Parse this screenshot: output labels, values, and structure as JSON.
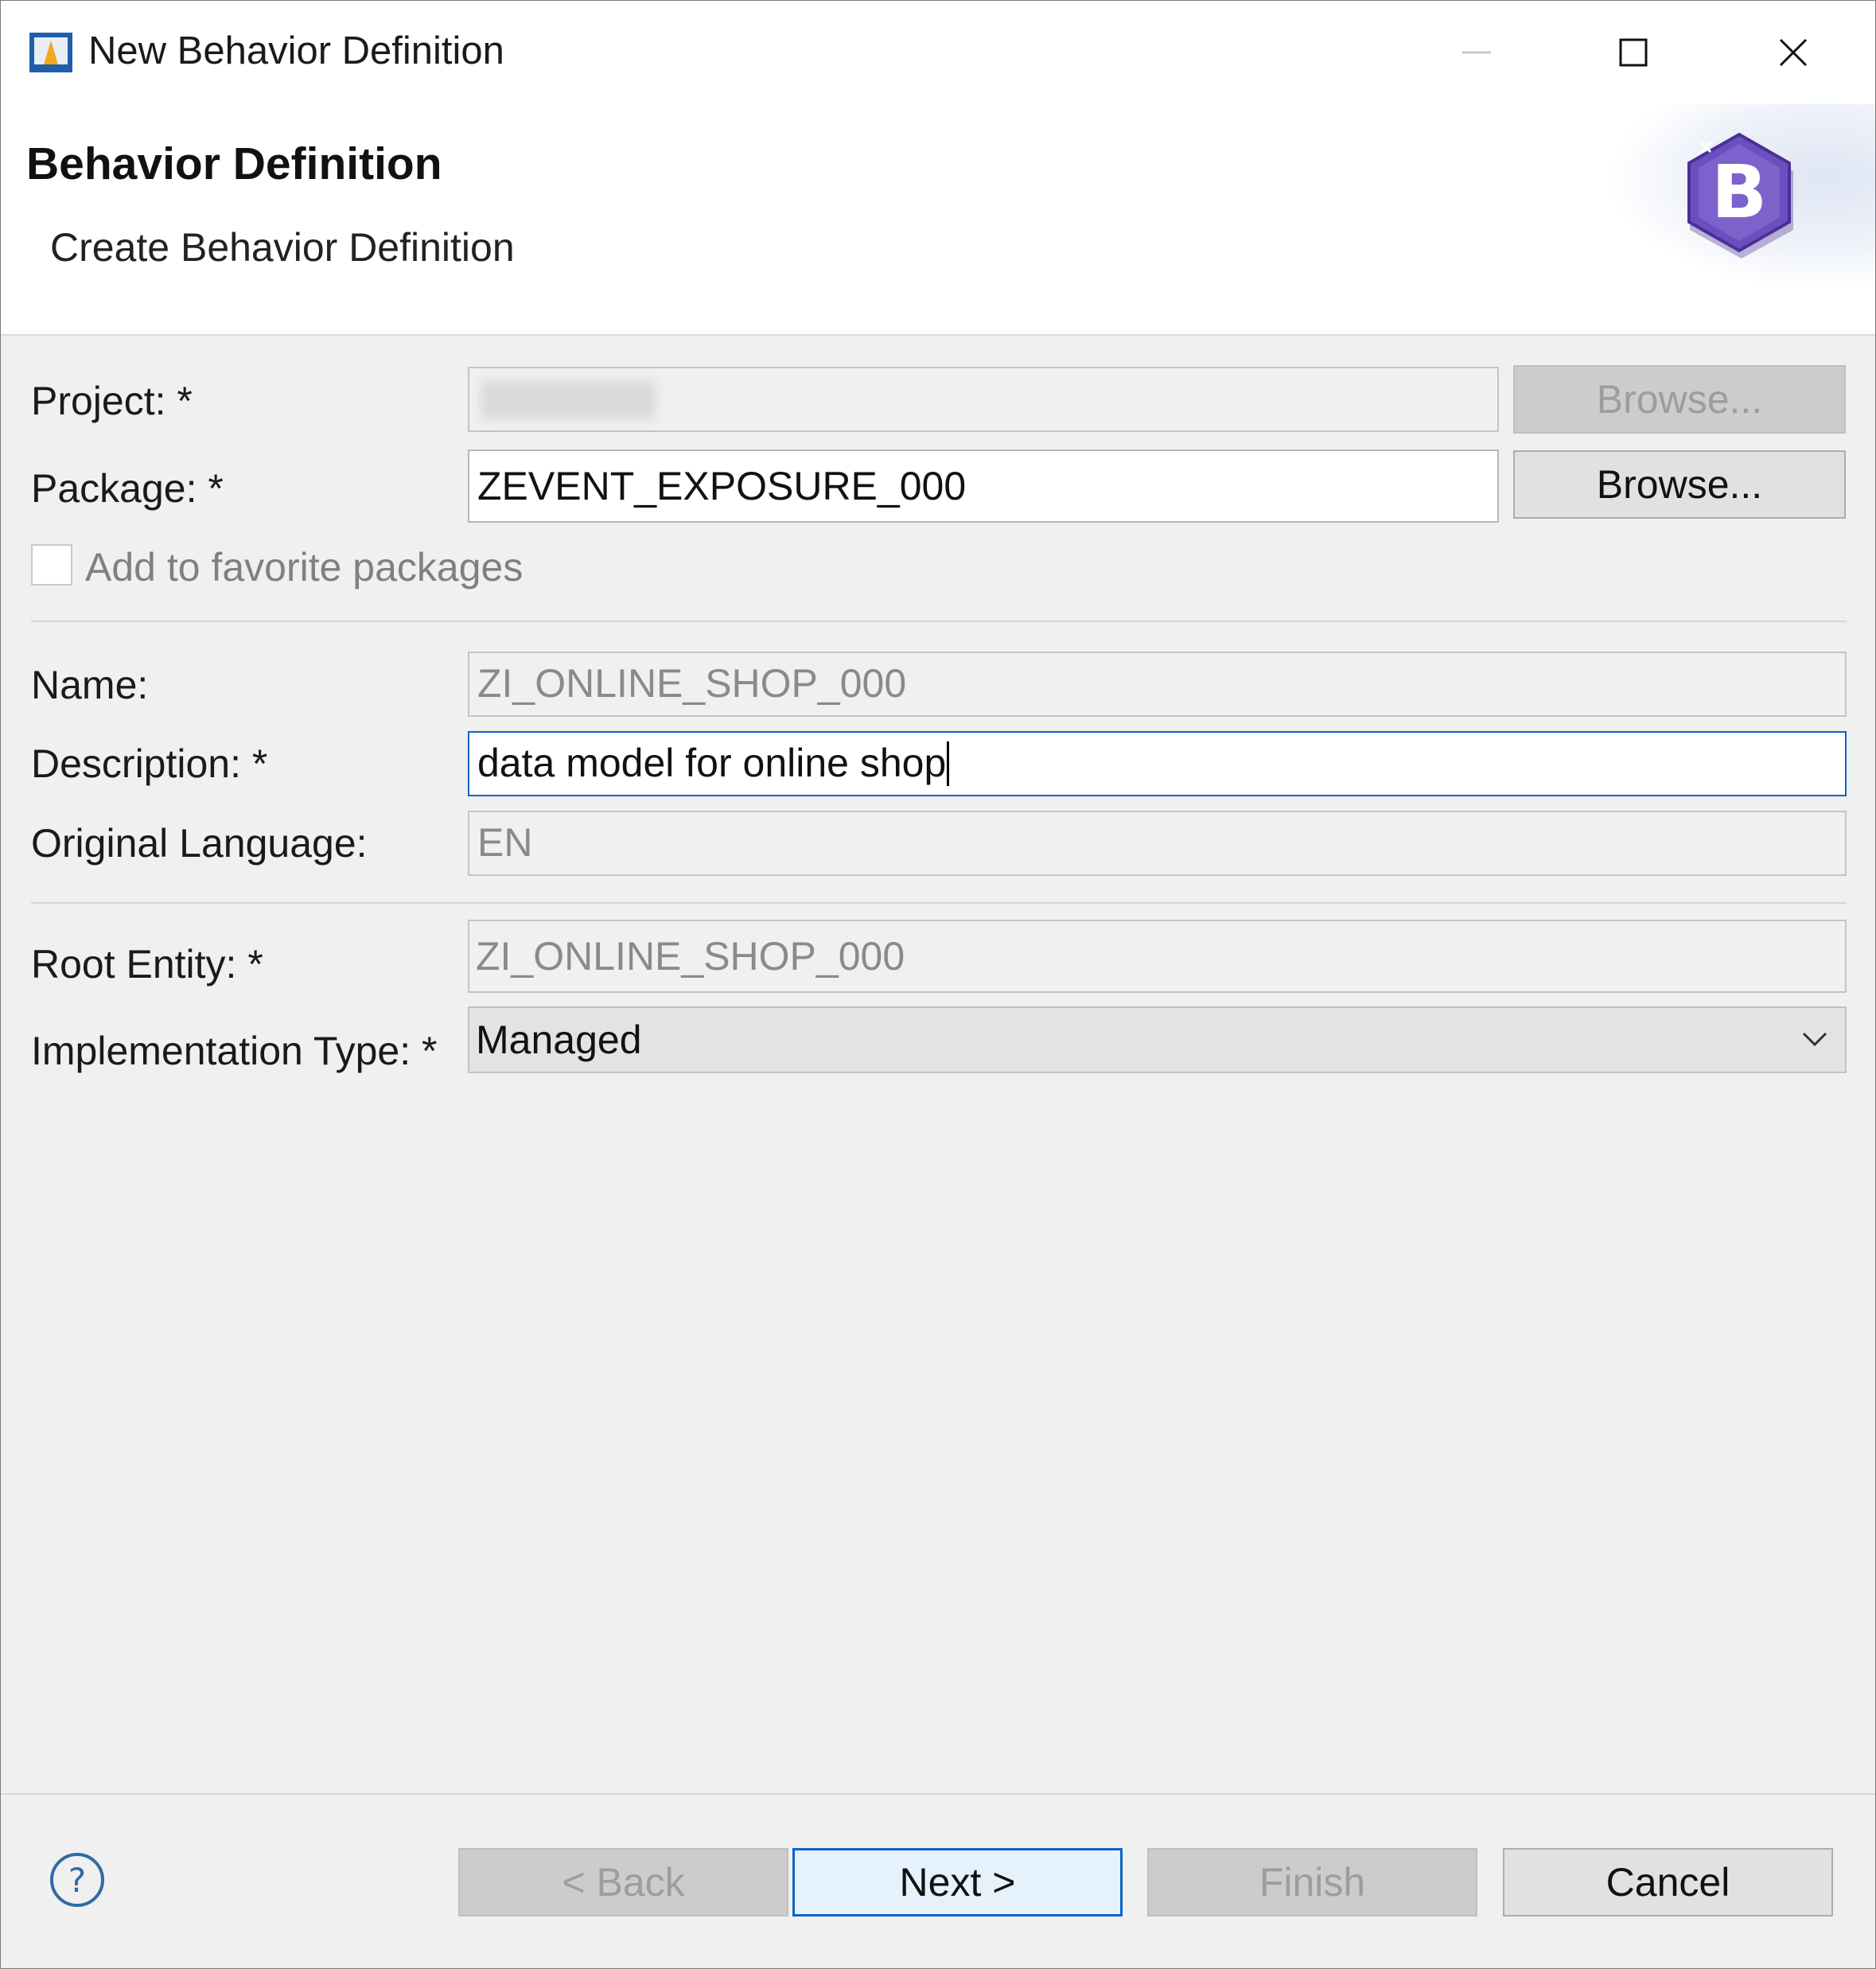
{
  "window": {
    "title": "New Behavior Definition"
  },
  "header": {
    "title": "Behavior Definition",
    "subtitle": "Create Behavior Definition",
    "logo_icon": "behavior-definition-b-hexagon-icon",
    "logo_letter": "B"
  },
  "form": {
    "project": {
      "label": "Project: *",
      "value": "",
      "browse_label": "Browse..."
    },
    "package": {
      "label": "Package: *",
      "value": "ZEVENT_EXPOSURE_000",
      "browse_label": "Browse..."
    },
    "favorite": {
      "label": "Add to favorite packages",
      "checked": false
    },
    "name": {
      "label": "Name:",
      "value": "ZI_ONLINE_SHOP_000"
    },
    "description": {
      "label": "Description: *",
      "value": "data model for online shop"
    },
    "original_language": {
      "label": "Original Language:",
      "value": "EN"
    },
    "root_entity": {
      "label": "Root Entity: *",
      "value": "ZI_ONLINE_SHOP_000"
    },
    "implementation_type": {
      "label": "Implementation Type: *",
      "value": "Managed"
    }
  },
  "footer": {
    "back_label": "< Back",
    "next_label": "Next >",
    "finish_label": "Finish",
    "cancel_label": "Cancel"
  },
  "colors": {
    "focus_border": "#0a64c8",
    "logo_purple": "#6c4fbf"
  }
}
